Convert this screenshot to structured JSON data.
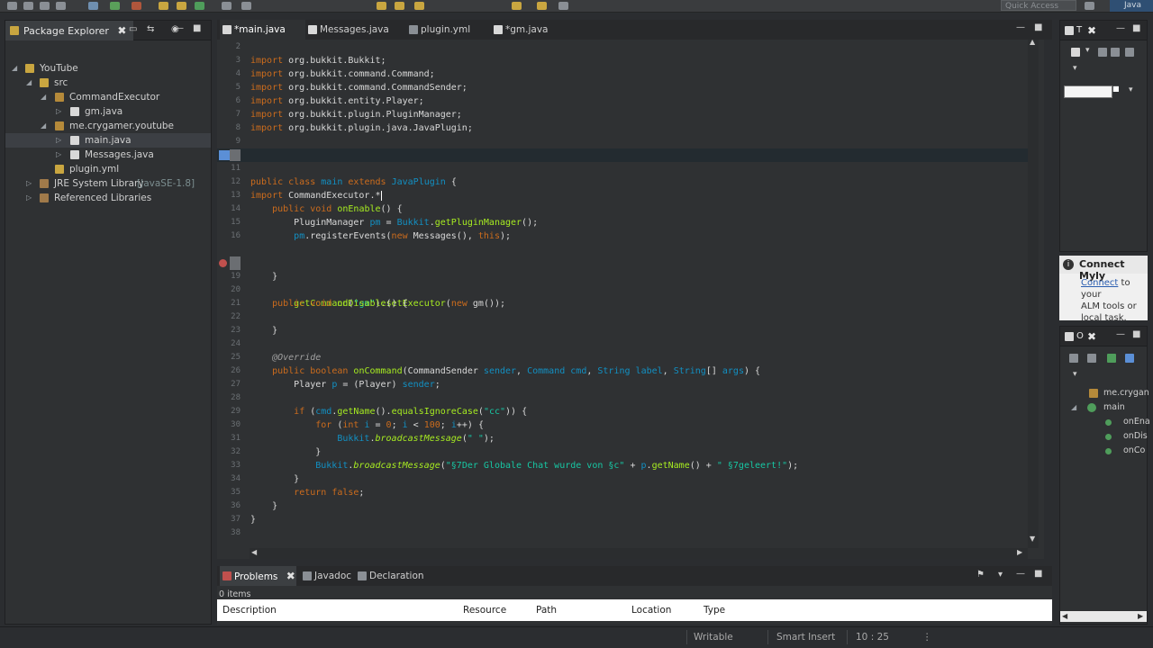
{
  "colors": {
    "keyword": "#cc6c1d",
    "type": "#1290c3",
    "string": "#17c6a3",
    "method": "#a7ec21",
    "editor_bg": "#2f3133",
    "current_line": "#232b30"
  },
  "toolbar": {
    "quick_access_placeholder": "Quick Access",
    "perspective_label": "Java"
  },
  "package_explorer": {
    "title": "Package Explorer",
    "tree": [
      {
        "label": "YouTube",
        "icon": "project-icon"
      },
      {
        "label": "src",
        "icon": "source-folder-icon"
      },
      {
        "label": "CommandExecutor",
        "icon": "package-icon"
      },
      {
        "label": "gm.java",
        "icon": "java-file-icon"
      },
      {
        "label": "me.crygamer.youtube",
        "icon": "package-icon"
      },
      {
        "label": "main.java",
        "icon": "java-file-icon"
      },
      {
        "label": "Messages.java",
        "icon": "java-file-icon"
      },
      {
        "label": "plugin.yml",
        "icon": "yml-file-icon"
      },
      {
        "label": "JRE System Library",
        "suffix": "[JavaSE-1.8]",
        "icon": "library-icon"
      },
      {
        "label": "Referenced Libraries",
        "icon": "library-icon"
      }
    ]
  },
  "editor": {
    "tabs": [
      {
        "label": "*main.java"
      },
      {
        "label": "Messages.java"
      },
      {
        "label": "plugin.yml"
      },
      {
        "label": "*gm.java"
      }
    ],
    "line_numbers": [
      "2",
      "3",
      "4",
      "5",
      "6",
      "7",
      "8",
      "9",
      "",
      "11",
      "12",
      "13",
      "14",
      "15",
      "16",
      "",
      "18",
      "19",
      "20",
      "21",
      "22",
      "23",
      "24",
      "25",
      "26",
      "27",
      "28",
      "29",
      "30",
      "31",
      "32",
      "33",
      "34",
      "35",
      "36",
      "37",
      "38"
    ]
  },
  "bottom_panel": {
    "tabs": [
      {
        "label": "Problems"
      },
      {
        "label": "Javadoc"
      },
      {
        "label": "Declaration"
      }
    ],
    "items_count": "0 items",
    "columns": [
      "Description",
      "Resource",
      "Path",
      "Location",
      "Type"
    ]
  },
  "mylyn": {
    "title": "Connect Myly",
    "link": "Connect",
    "line1_rest": "to your",
    "line2": "ALM tools or",
    "line3": "local task."
  },
  "outline": {
    "title": "O",
    "items": [
      {
        "label": "me.crygan"
      },
      {
        "label": "main"
      },
      {
        "label": "onEna"
      },
      {
        "label": "onDis"
      },
      {
        "label": "onCo"
      }
    ]
  },
  "status_bar": {
    "writable": "Writable",
    "insert_mode": "Smart Insert",
    "position": "10 : 25"
  }
}
